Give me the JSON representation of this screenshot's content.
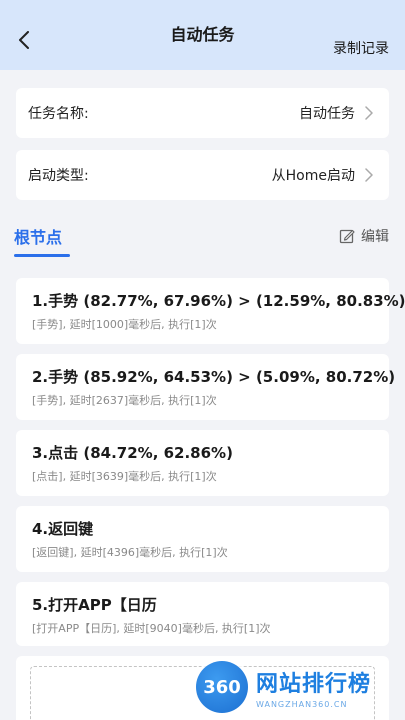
{
  "header": {
    "title": "自动任务",
    "right_link": "录制记录"
  },
  "fields": [
    {
      "label": "任务名称:",
      "value": "自动任务"
    },
    {
      "label": "启动类型:",
      "value": "从Home启动"
    }
  ],
  "section": {
    "title": "根节点",
    "edit_label": "编辑"
  },
  "steps": [
    {
      "title": "1.手势 (82.77%, 67.96%) > (12.59%, 80.83%)",
      "desc": "[手势], 延时[1000]毫秒后, 执行[1]次"
    },
    {
      "title": "2.手势 (85.92%, 64.53%) > (5.09%, 80.72%)",
      "desc": "[手势], 延时[2637]毫秒后, 执行[1]次"
    },
    {
      "title": "3.点击 (84.72%, 62.86%)",
      "desc": "[点击], 延时[3639]毫秒后, 执行[1]次"
    },
    {
      "title": "4.返回键",
      "desc": "[返回键], 延时[4396]毫秒后, 执行[1]次"
    },
    {
      "title": "5.打开APP【日历",
      "desc": "[打开APP【日历], 延时[9040]毫秒后, 执行[1]次"
    }
  ],
  "watermark": {
    "badge": "360",
    "main": "网站排行榜",
    "sub": "WANGZHAN360.CN"
  },
  "colors": {
    "header_bg": "#d7e6fb",
    "accent": "#2b6fea",
    "page_bg": "#f2f3f7"
  },
  "icons": {
    "back": "chevron-left-icon",
    "field_arrow": "chevron-right-icon",
    "edit": "edit-icon",
    "add": "plus-circle-icon"
  }
}
